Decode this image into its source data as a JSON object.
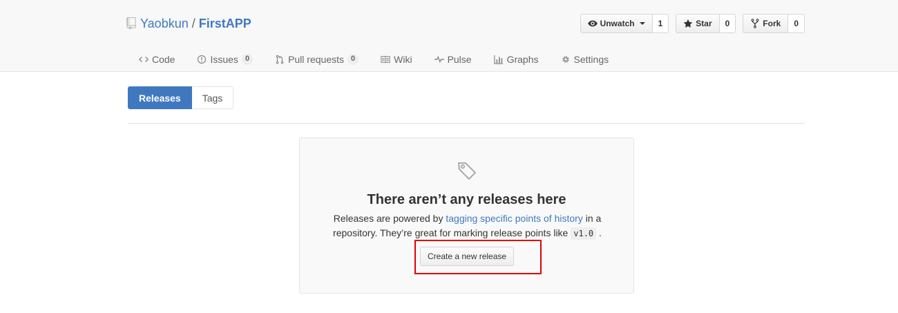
{
  "repo": {
    "owner": "Yaobkun",
    "separator": "/",
    "name": "FirstAPP"
  },
  "actions": {
    "watch": {
      "label": "Unwatch",
      "count": "1"
    },
    "star": {
      "label": "Star",
      "count": "0"
    },
    "fork": {
      "label": "Fork",
      "count": "0"
    }
  },
  "tabs": [
    {
      "label": "Code",
      "icon": "code-icon"
    },
    {
      "label": "Issues",
      "icon": "issue-icon",
      "count": "0"
    },
    {
      "label": "Pull requests",
      "icon": "pull-request-icon",
      "count": "0"
    },
    {
      "label": "Wiki",
      "icon": "book-icon"
    },
    {
      "label": "Pulse",
      "icon": "pulse-icon"
    },
    {
      "label": "Graphs",
      "icon": "graph-icon"
    },
    {
      "label": "Settings",
      "icon": "gear-icon"
    }
  ],
  "subnav": {
    "selected": "Releases",
    "other": "Tags"
  },
  "blankslate": {
    "icon": "tag-icon",
    "heading": "There aren’t any releases here",
    "desc_before": "Releases are powered by ",
    "desc_link": "tagging specific points of history",
    "desc_after": " in a repository. They’re great for marking release points like ",
    "desc_code": "v1.0",
    "desc_end": ".",
    "button": "Create a new release"
  },
  "colors": {
    "accent": "#4078c0",
    "highlight": "#e00000"
  }
}
